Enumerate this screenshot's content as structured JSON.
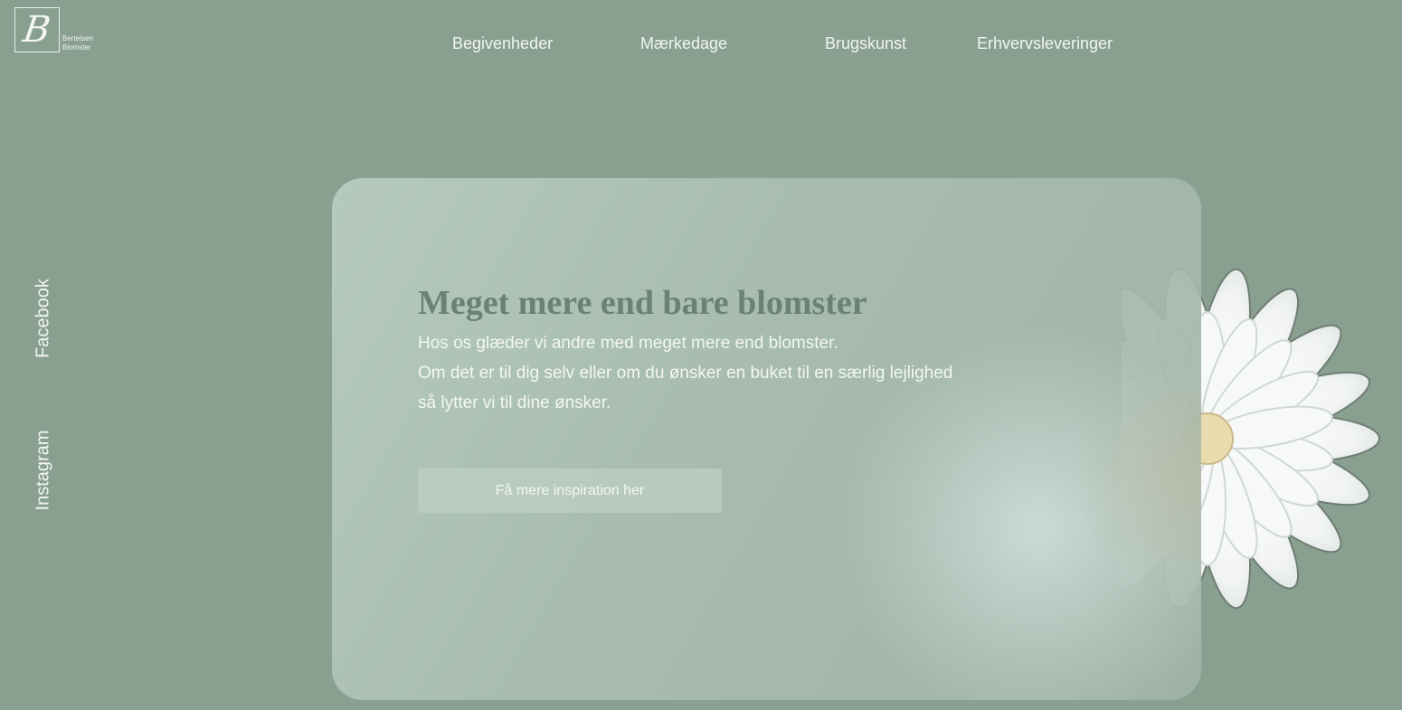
{
  "brand": {
    "logo_letter": "B",
    "name_line1": "Bertelsen",
    "name_line2": "Blomster"
  },
  "nav": {
    "items": [
      {
        "label": "Begivenheder"
      },
      {
        "label": "Mærkedage"
      },
      {
        "label": "Brugskunst"
      },
      {
        "label": "Erhvervsleveringer"
      }
    ]
  },
  "social": {
    "facebook": "Facebook",
    "instagram": "Instagram"
  },
  "hero": {
    "title": "Meget mere end bare blomster",
    "lines": [
      "Hos os glæder vi andre med meget mere end blomster.",
      "Om det er til dig selv eller om du ønsker en buket til en særlig lejlighed",
      "så lytter vi til dine ønsker."
    ],
    "cta_label": "Få mere inspiration her"
  },
  "colors": {
    "background": "#89a090",
    "headline": "#6b8273",
    "text": "#f1f4f1"
  },
  "icons": {
    "flower": "white-gerbera-flower"
  }
}
